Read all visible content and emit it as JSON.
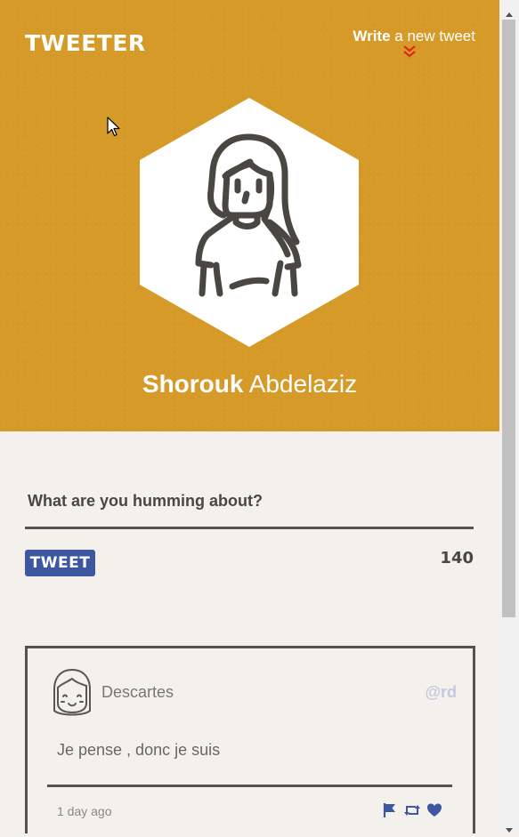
{
  "header": {
    "logo": "TWEETER",
    "write_strong": "Write",
    "write_rest": " a new tweet"
  },
  "profile": {
    "first_name": "Shorouk",
    "last_name": " Abdelaziz"
  },
  "composer": {
    "label": "What are you humming about?",
    "button_label": "TWEET",
    "counter": "140"
  },
  "tweet": {
    "name": "Descartes",
    "handle": "@rd",
    "text": "Je pense , donc je suis",
    "time": "1 day ago"
  },
  "colors": {
    "hero": "#d59a28",
    "accent_blue": "#3d57a0",
    "chevron_red": "#e02b1b"
  },
  "icons": [
    "chevron-double-down-icon",
    "flag-icon",
    "retweet-icon",
    "heart-icon"
  ]
}
